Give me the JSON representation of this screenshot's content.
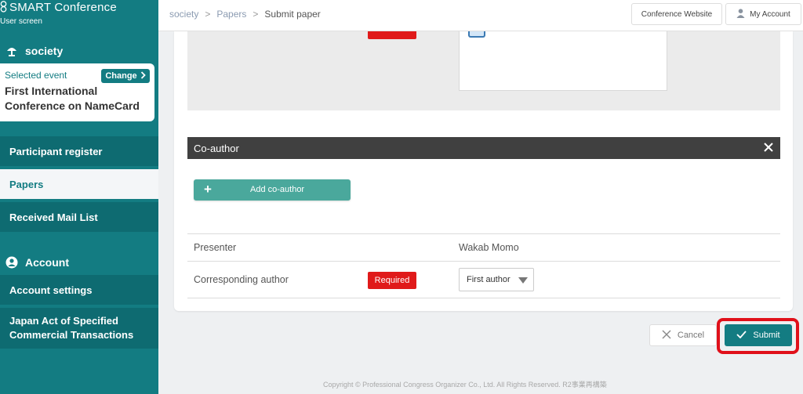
{
  "app": {
    "name": "SMART Conference",
    "subtitle": "User screen"
  },
  "sidebar": {
    "society": {
      "label": "society"
    },
    "event": {
      "selected_label": "Selected event",
      "change_label": "Change",
      "name": "First International Conference on NameCard"
    },
    "items": [
      {
        "label": "Participant register"
      },
      {
        "label": "Papers"
      },
      {
        "label": "Received Mail List"
      }
    ],
    "account": {
      "label": "Account",
      "items": [
        {
          "label": "Account settings"
        },
        {
          "label": "Japan Act of Specified Commercial Transactions"
        }
      ]
    }
  },
  "header": {
    "breadcrumb": [
      "society",
      "Papers",
      "Submit paper"
    ],
    "separator": ">",
    "conference_website": "Conference Website",
    "my_account": "My Account"
  },
  "coauthor": {
    "title": "Co-author",
    "add_label": "Add co-author"
  },
  "rows": {
    "presenter": {
      "label": "Presenter",
      "value": "Wakab Momo"
    },
    "corresponding": {
      "label": "Corresponding author",
      "required": "Required",
      "selected": "First author"
    }
  },
  "actions": {
    "cancel": "Cancel",
    "submit": "Submit"
  },
  "footer": "Copyright © Professional Congress Organizer Co., Ltd. All Rights Reserved. R2事業再構築",
  "colors": {
    "accent": "#137c82",
    "required": "#e01a1a",
    "add_button": "#4aa89c",
    "highlight": "#e0101a"
  }
}
